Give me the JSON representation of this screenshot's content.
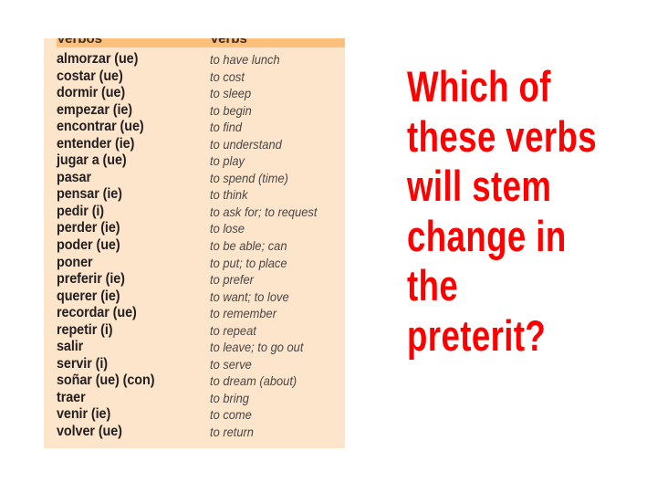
{
  "vocab_table": {
    "header": {
      "col_spanish": "Verbos",
      "col_english": "Verbs"
    },
    "colors": {
      "panel_bg": "#fde5cc",
      "header_bg": "#fcbf7c",
      "verb_text": "#231f20",
      "meaning_text": "#4a4645"
    },
    "rows": [
      {
        "verb": "almorzar (ue)",
        "meaning": "to have lunch"
      },
      {
        "verb": "costar (ue)",
        "meaning": "to cost"
      },
      {
        "verb": "dormir (ue)",
        "meaning": "to sleep"
      },
      {
        "verb": "empezar (ie)",
        "meaning": "to begin"
      },
      {
        "verb": "encontrar (ue)",
        "meaning": "to find"
      },
      {
        "verb": "entender (ie)",
        "meaning": "to understand"
      },
      {
        "verb": "jugar a (ue)",
        "meaning": "to play"
      },
      {
        "verb": "pasar",
        "meaning": "to spend (time)"
      },
      {
        "verb": "pensar (ie)",
        "meaning": "to think"
      },
      {
        "verb": "pedir (i)",
        "meaning": "to ask for; to request"
      },
      {
        "verb": "perder (ie)",
        "meaning": "to lose"
      },
      {
        "verb": "poder (ue)",
        "meaning": "to be able; can"
      },
      {
        "verb": "poner",
        "meaning": "to put; to place"
      },
      {
        "verb": "preferir (ie)",
        "meaning": "to prefer"
      },
      {
        "verb": "querer (ie)",
        "meaning": "to want; to love"
      },
      {
        "verb": "recordar (ue)",
        "meaning": "to remember"
      },
      {
        "verb": "repetir (i)",
        "meaning": "to repeat"
      },
      {
        "verb": "salir",
        "meaning": "to leave; to go out"
      },
      {
        "verb": "servir (i)",
        "meaning": "to serve"
      },
      {
        "verb": "soñar (ue) (con)",
        "meaning": "to dream (about)"
      },
      {
        "verb": "traer",
        "meaning": "to bring"
      },
      {
        "verb": "venir (ie)",
        "meaning": "to come"
      },
      {
        "verb": "volver (ue)",
        "meaning": "to return"
      }
    ]
  },
  "question": {
    "color": "#ff0000",
    "lines": [
      "Which of",
      "these verbs",
      "will stem",
      "change in",
      "the",
      "preterit?"
    ]
  }
}
